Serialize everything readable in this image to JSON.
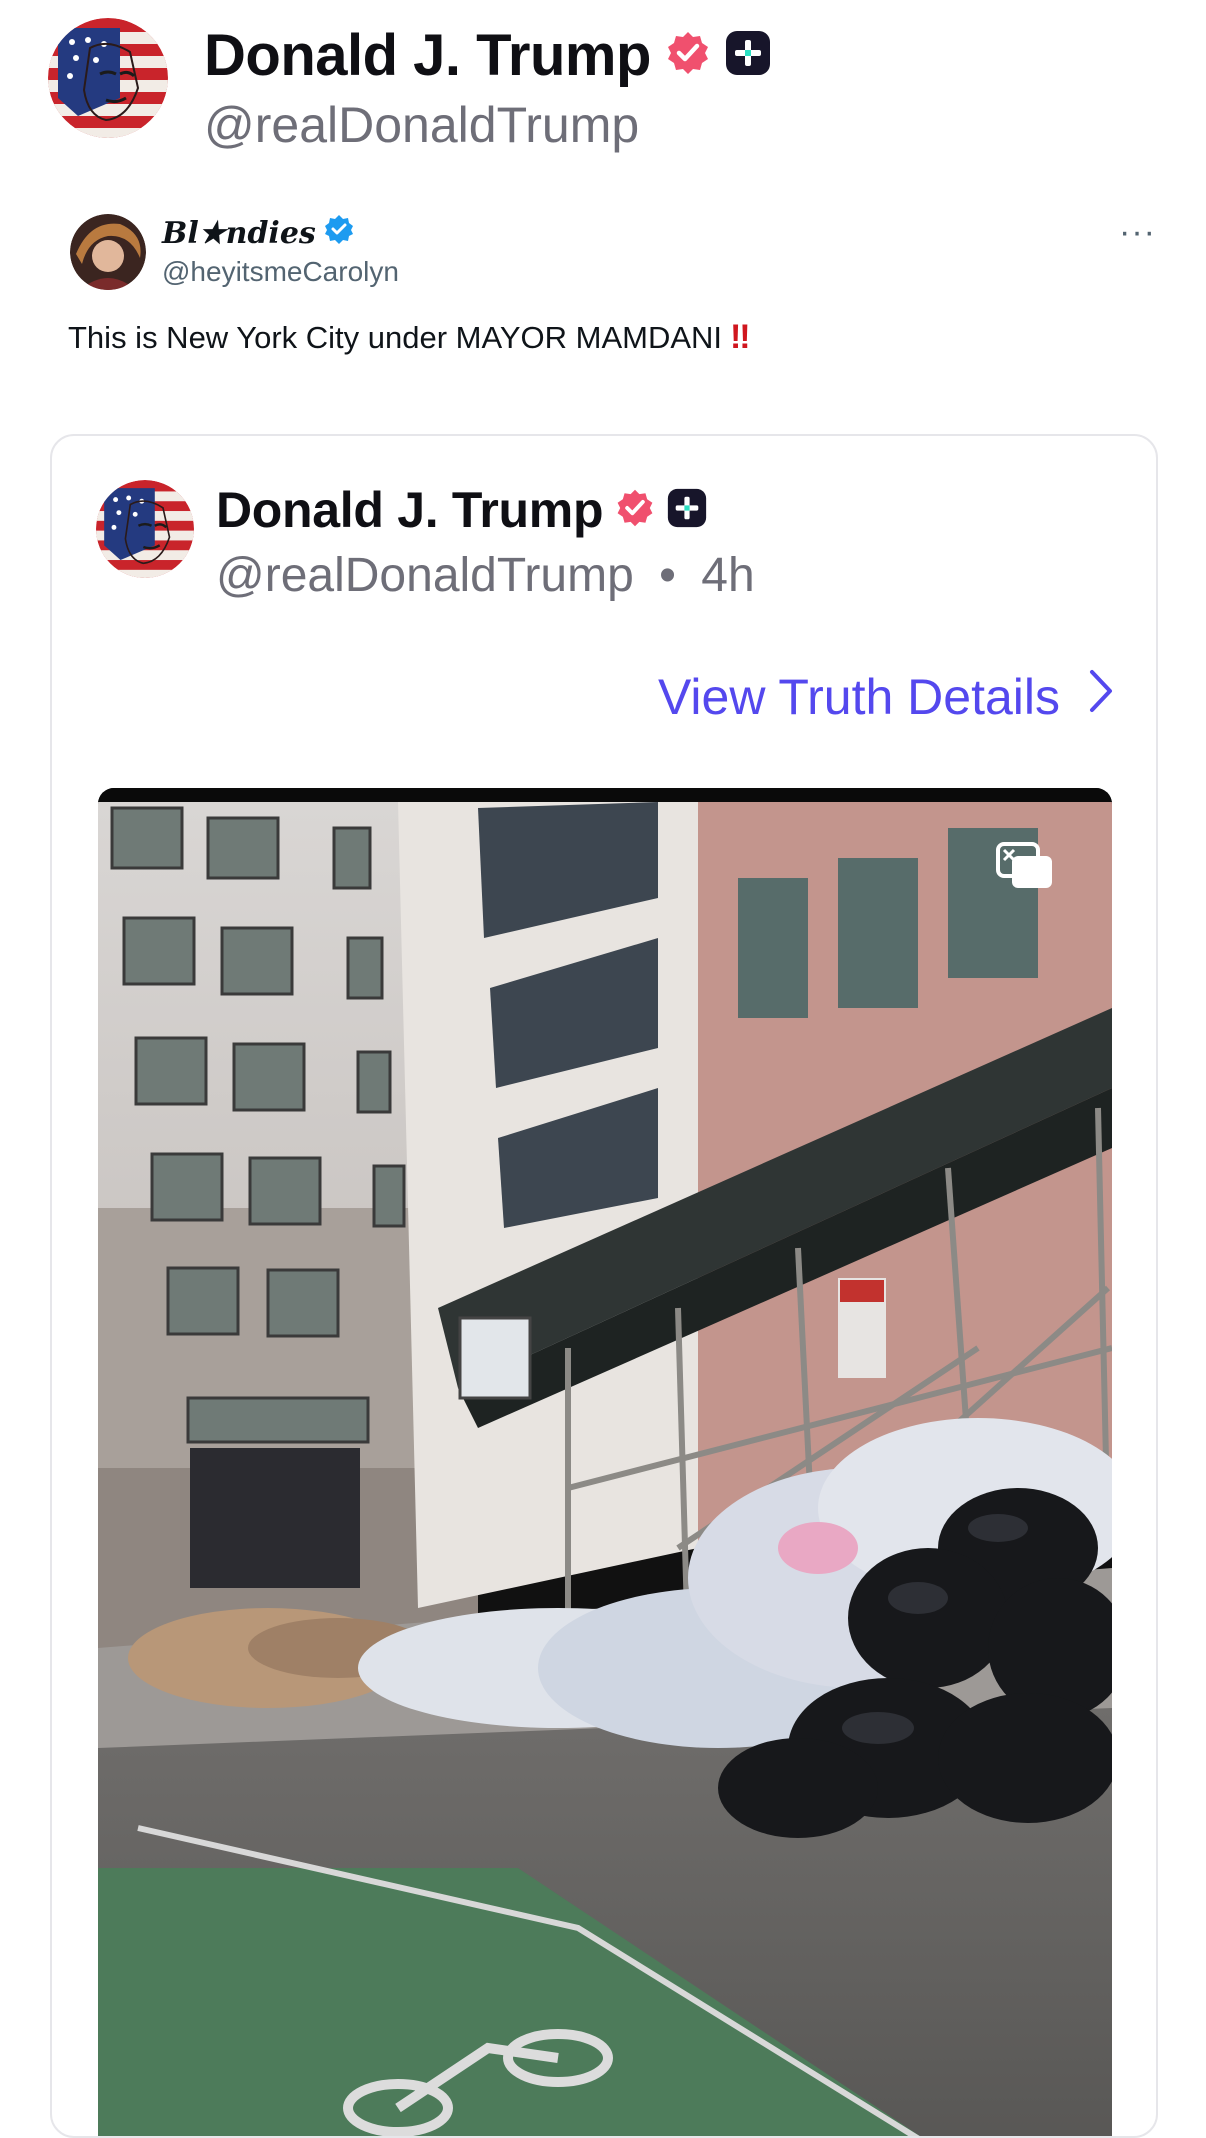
{
  "post": {
    "author_name": "Donald J. Trump",
    "author_handle": "@realDonaldTrump"
  },
  "embedded_x_post": {
    "display_name": "Bl★ndies",
    "handle": "@heyitsmeCarolyn",
    "more_label": "···",
    "text": "This is New York City under MAYOR MAMDANI",
    "emphasis": "‼"
  },
  "quoted_truth": {
    "author_name": "Donald J. Trump",
    "author_handle": "@realDonaldTrump",
    "separator": "•",
    "age": "4h",
    "details_link": "View Truth Details"
  },
  "colors": {
    "verified_badge": "#f0506e",
    "plus_badge": "#17152a",
    "link": "#5448ee",
    "x_verified": "#1d9bf0"
  },
  "icons": {
    "verified": "verified-badge-icon",
    "plus": "truth-plus-icon",
    "chevron": "chevron-right-icon",
    "media_toggle": "media-toggle-icon"
  }
}
